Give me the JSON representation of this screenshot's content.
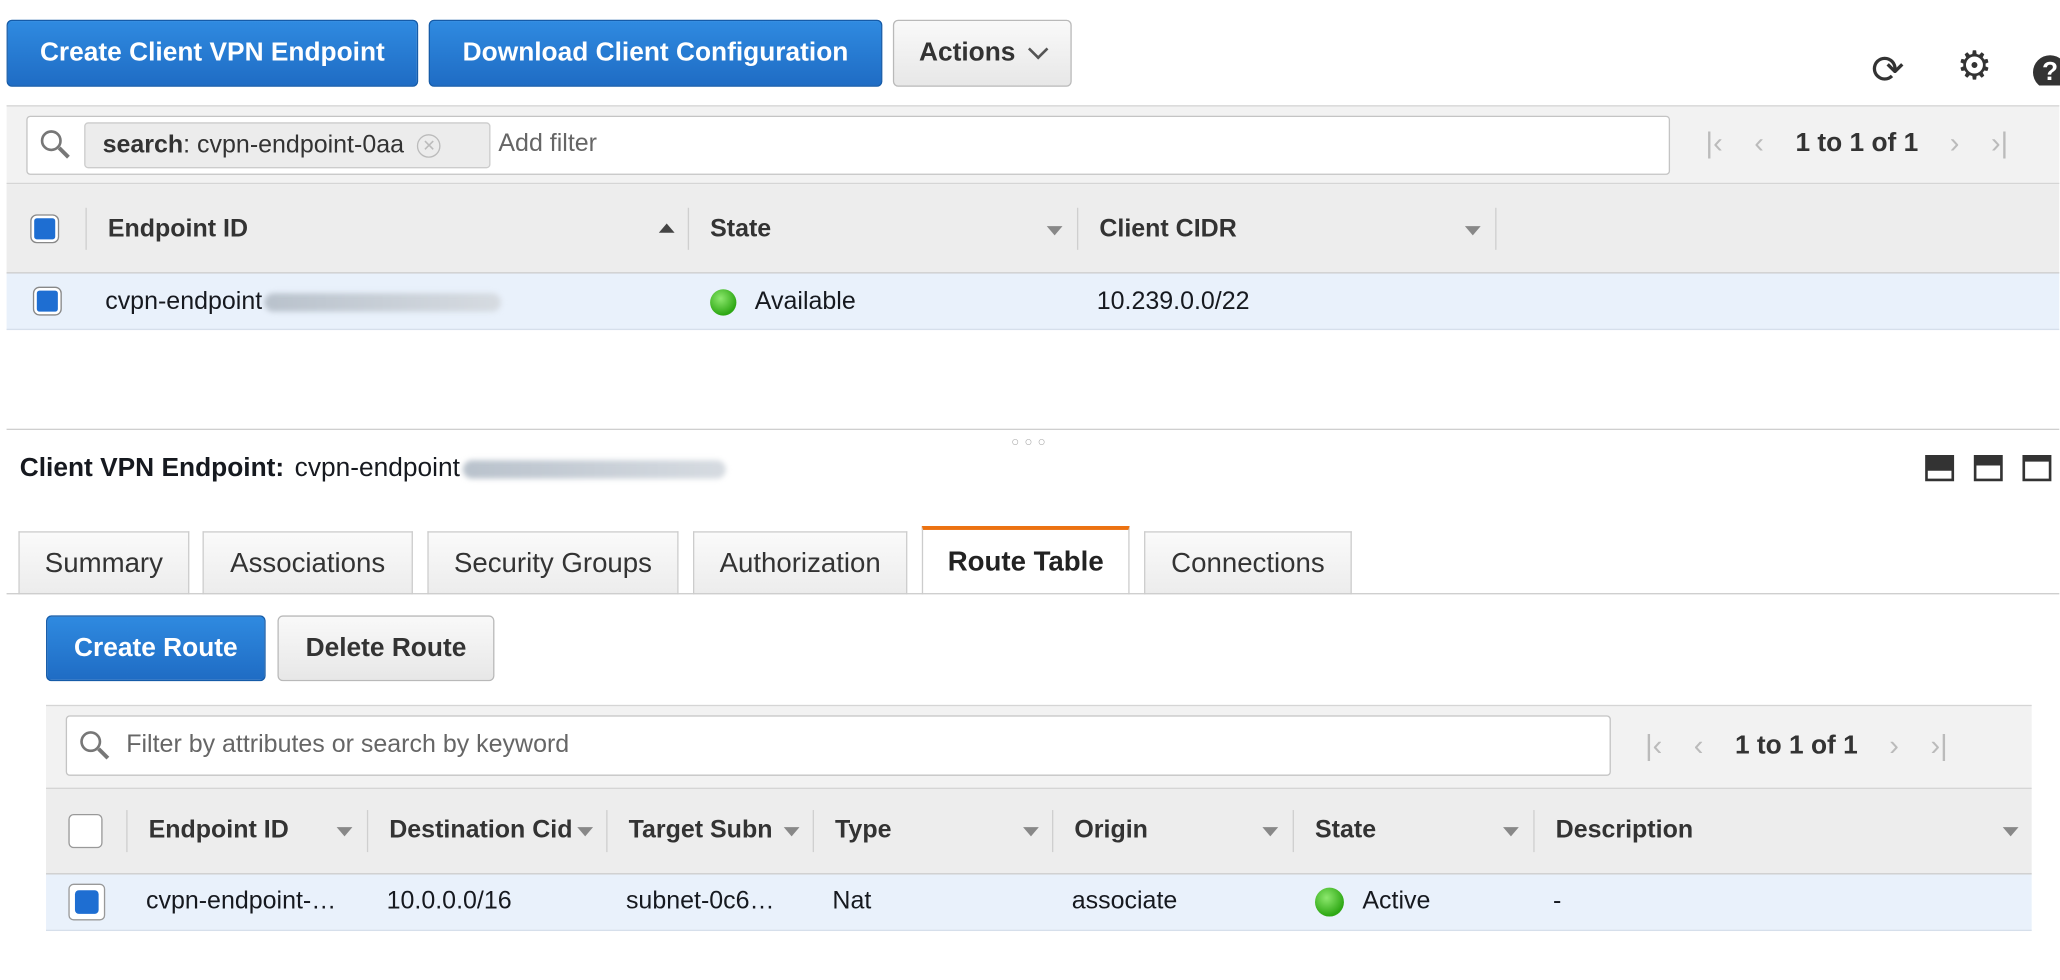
{
  "toolbar": {
    "create_endpoint_label": "Create Client VPN Endpoint",
    "download_config_label": "Download Client Configuration",
    "actions_label": "Actions",
    "icons": [
      "refresh-icon",
      "gear-icon",
      "help-icon"
    ]
  },
  "top_filter": {
    "token_key": "search",
    "token_value": " : cvpn-endpoint-0aa",
    "placeholder": "Add filter",
    "pager_text": "1 to 1 of 1"
  },
  "top_table": {
    "columns": [
      "Endpoint ID",
      "State",
      "Client CIDR"
    ],
    "rows": [
      {
        "endpoint_id": "cvpn-endpoint",
        "state": "Available",
        "client_cidr": "10.239.0.0/22"
      }
    ]
  },
  "detail": {
    "title_label": "Client VPN Endpoint:",
    "title_value": "cvpn-endpoint",
    "tabs": [
      "Summary",
      "Associations",
      "Security Groups",
      "Authorization",
      "Route Table",
      "Connections"
    ],
    "active_tab": "Route Table",
    "create_route_label": "Create Route",
    "delete_route_label": "Delete Route",
    "filter_placeholder": "Filter by attributes or search by keyword",
    "pager_text": "1 to 1 of 1",
    "columns": [
      "Endpoint ID",
      "Destination Cid",
      "Target Subn",
      "Type",
      "Origin",
      "State",
      "Description"
    ],
    "rows": [
      {
        "endpoint_id": "cvpn-endpoint-…",
        "destination_cidr": "10.0.0.0/16",
        "target_subnet": "subnet-0c6…",
        "type": "Nat",
        "origin": "associate",
        "state": "Active",
        "description": "-"
      }
    ]
  },
  "colors": {
    "primary": "#1f6cc4",
    "active_tab_accent": "#ec7211",
    "status_green": "#2ea814",
    "row_selected": "#e9f1fb"
  }
}
